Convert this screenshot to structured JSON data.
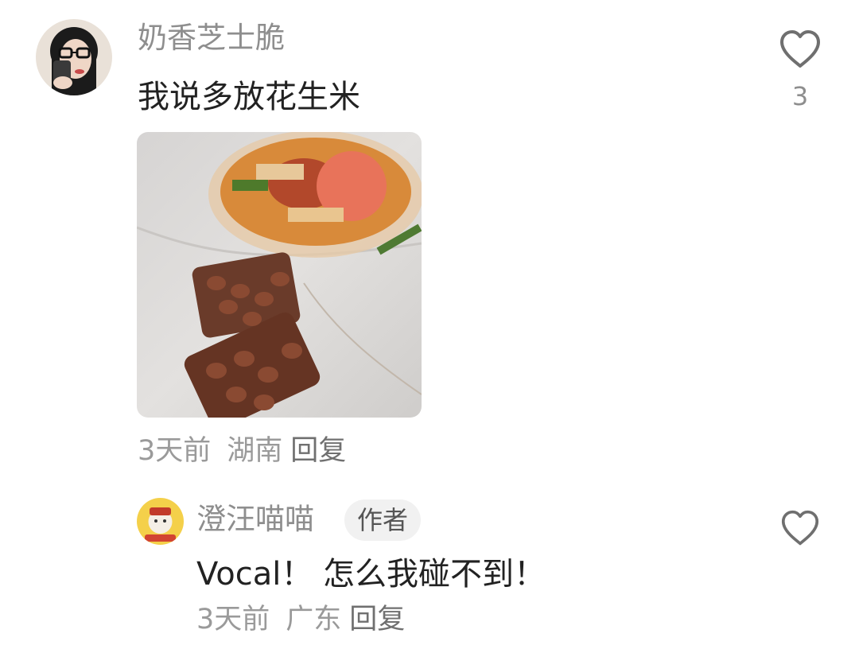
{
  "comments": [
    {
      "username": "奶香芝士脆",
      "text": "我说多放花生米",
      "likes": "3",
      "has_image": true,
      "time": "3天前",
      "location": "湖南",
      "reply_label": "回复",
      "icons": {
        "like": "heart-outline-icon"
      }
    },
    {
      "username": "澄汪喵喵",
      "badge": "作者",
      "text": "Vocal！ 怎么我碰不到！",
      "time": "3天前",
      "location": "广东",
      "reply_label": "回复",
      "icons": {
        "like": "heart-outline-icon"
      }
    }
  ],
  "colors": {
    "username": "#8e8e8e",
    "text": "#222222",
    "meta": "#9a9a9a",
    "badge_bg": "#f1f1f1"
  }
}
